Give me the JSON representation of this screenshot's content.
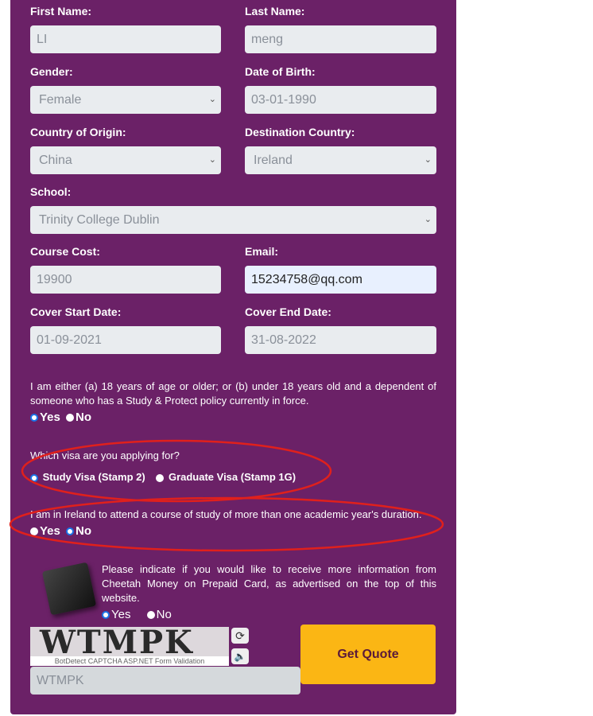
{
  "form": {
    "first_name": {
      "label": "First Name:",
      "value": "LI"
    },
    "last_name": {
      "label": "Last Name:",
      "value": "meng"
    },
    "gender": {
      "label": "Gender:",
      "value": "Female"
    },
    "dob": {
      "label": "Date of Birth:",
      "value": "03-01-1990"
    },
    "country_origin": {
      "label": "Country of Origin:",
      "value": "China"
    },
    "destination": {
      "label": "Destination Country:",
      "value": "Ireland"
    },
    "school": {
      "label": "School:",
      "value": "Trinity College Dublin"
    },
    "course_cost": {
      "label": "Course Cost:",
      "value": "19900"
    },
    "email": {
      "label": "Email:",
      "value": "15234758@qq.com"
    },
    "cover_start": {
      "label": "Cover Start Date:",
      "value": "01-09-2021"
    },
    "cover_end": {
      "label": "Cover End Date:",
      "value": "31-08-2022"
    }
  },
  "age_question": {
    "text": "I am either (a) 18 years of age or older; or (b) under 18 years old and a dependent of someone who has a Study & Protect policy currently in force.",
    "yes": "Yes",
    "no": "No",
    "selected": "Yes"
  },
  "visa_question": {
    "text": "Which visa are you applying for?",
    "option1": "Study Visa (Stamp 2)",
    "option2": "Graduate Visa (Stamp 1G)",
    "selected": "Study Visa (Stamp 2)"
  },
  "duration_question": {
    "text": "I am in Ireland to attend a course of study of more than one academic year's duration.",
    "yes": "Yes",
    "no": "No",
    "selected": "No"
  },
  "info_question": {
    "text": "Please indicate if you would like to receive more information from Cheetah Money on Prepaid Card, as advertised on the top of this website.",
    "yes": "Yes",
    "no": "No",
    "selected": "Yes"
  },
  "captcha": {
    "image_text": "WTMPK",
    "caption": "BotDetect CAPTCHA ASP.NET Form Validation",
    "input_value": "WTMPK"
  },
  "submit_label": "Get Quote",
  "colors": {
    "panel": "#6b2167",
    "button": "#fbb614",
    "annotation": "#e0201c"
  }
}
